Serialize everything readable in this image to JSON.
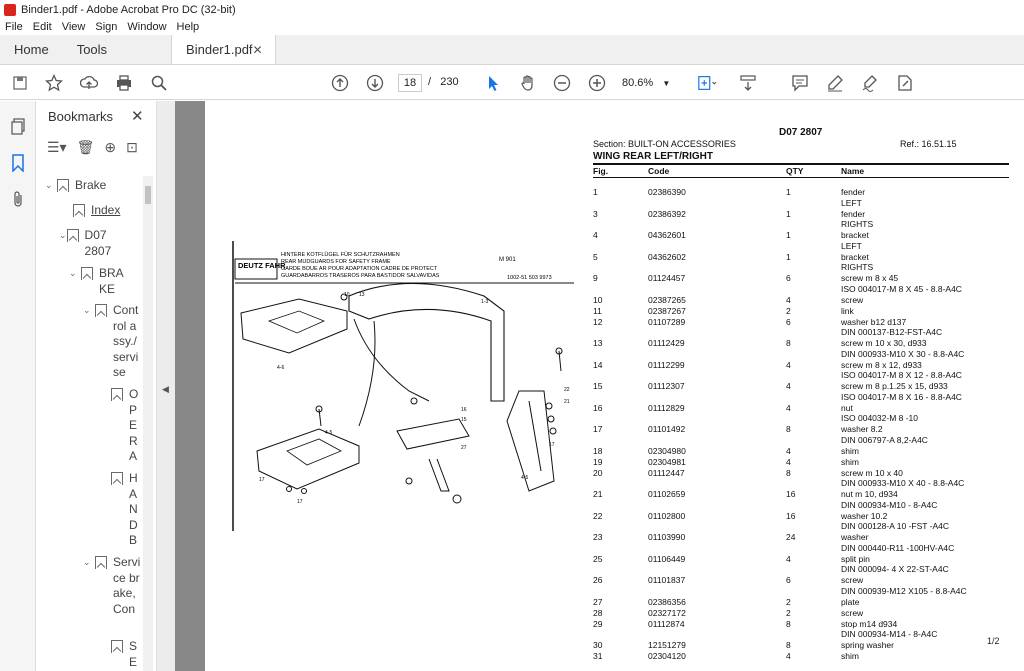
{
  "window": {
    "title": "Binder1.pdf - Adobe Acrobat Pro DC (32-bit)"
  },
  "menu": [
    "File",
    "Edit",
    "View",
    "Sign",
    "Window",
    "Help"
  ],
  "tabs": {
    "home": "Home",
    "tools": "Tools",
    "doc": "Binder1.pdf"
  },
  "toolbar": {
    "page_current": "18",
    "page_sep": "/",
    "page_total": "230",
    "zoom": "80.6%"
  },
  "bookmarks": {
    "title": "Bookmarks",
    "items": [
      {
        "label": "Brake",
        "caret": "⌄"
      },
      {
        "label": "Index",
        "caret": ""
      },
      {
        "label": "D07 2807",
        "caret": "⌄"
      },
      {
        "label": "BRAKE",
        "caret": "⌄"
      },
      {
        "label": "Control assy./servise",
        "caret": "⌄"
      },
      {
        "label": "OPERA",
        "caret": ""
      },
      {
        "label": "HANDB",
        "caret": ""
      },
      {
        "label": "Service brake, Con",
        "caret": "⌄"
      },
      {
        "label": "SE",
        "caret": ""
      }
    ]
  },
  "page": {
    "doc_code": "D07 2807",
    "section": "Section: BUILT-ON ACCESSORIES",
    "ref": "Ref.: 16.51.15",
    "heading": "WING REAR LEFT/RIGHT",
    "cols": [
      "Fig.",
      "Code",
      "QTY",
      "Name"
    ],
    "diagram_caption": [
      "HINTERE KOTFLÜGEL FÜR SCHUTZRAHMEN",
      "REAR MUDGUARDS FOR SAFETY FRAME",
      "GARDE BOUE AR POUR ADAPTATION CADRE DE PROTECT",
      "GUARDABARROS TRASEROS PARA BASTIDOR SALVAVIDAS"
    ],
    "diagram_brand": "DEUTZ FAHR",
    "diagram_code": "M 901",
    "diagram_ref": "1002-51 503 9973",
    "page_footer": "1/2",
    "rows": [
      {
        "fig": "1",
        "code": "02386390",
        "qty": "1",
        "name": "fender"
      },
      {
        "fig": "",
        "code": "",
        "qty": "",
        "name": "LEFT"
      },
      {
        "fig": "3",
        "code": "02386392",
        "qty": "1",
        "name": "fender"
      },
      {
        "fig": "",
        "code": "",
        "qty": "",
        "name": "RIGHTS"
      },
      {
        "fig": "4",
        "code": "04362601",
        "qty": "1",
        "name": "bracket"
      },
      {
        "fig": "",
        "code": "",
        "qty": "",
        "name": "LEFT"
      },
      {
        "fig": "5",
        "code": "04362602",
        "qty": "1",
        "name": "bracket"
      },
      {
        "fig": "",
        "code": "",
        "qty": "",
        "name": "RIGHTS"
      },
      {
        "fig": "9",
        "code": "01124457",
        "qty": "6",
        "name": "screw m 8 x 45"
      },
      {
        "fig": "",
        "code": "",
        "qty": "",
        "name": "ISO 004017-M 8 X 45 - 8.8-A4C"
      },
      {
        "fig": "10",
        "code": "02387265",
        "qty": "4",
        "name": "screw"
      },
      {
        "fig": "11",
        "code": "02387267",
        "qty": "2",
        "name": "link"
      },
      {
        "fig": "12",
        "code": "01107289",
        "qty": "6",
        "name": "washer b12 d137"
      },
      {
        "fig": "",
        "code": "",
        "qty": "",
        "name": "DIN 000137-B12-FST-A4C"
      },
      {
        "fig": "13",
        "code": "01112429",
        "qty": "8",
        "name": "screw m 10 x 30, d933"
      },
      {
        "fig": "",
        "code": "",
        "qty": "",
        "name": "DIN 000933-M10 X 30 - 8.8-A4C"
      },
      {
        "fig": "14",
        "code": "01112299",
        "qty": "4",
        "name": "screw m 8 x 12, d933"
      },
      {
        "fig": "",
        "code": "",
        "qty": "",
        "name": "ISO 004017-M 8 X 12 - 8.8-A4C"
      },
      {
        "fig": "15",
        "code": "01112307",
        "qty": "4",
        "name": "screw m 8 p.1.25 x 15, d933"
      },
      {
        "fig": "",
        "code": "",
        "qty": "",
        "name": "ISO 004017-M 8 X 16 - 8.8-A4C"
      },
      {
        "fig": "16",
        "code": "01112829",
        "qty": "4",
        "name": "nut"
      },
      {
        "fig": "",
        "code": "",
        "qty": "",
        "name": "ISO 004032-M 8 -10"
      },
      {
        "fig": "17",
        "code": "01101492",
        "qty": "8",
        "name": "washer 8.2"
      },
      {
        "fig": "",
        "code": "",
        "qty": "",
        "name": "DIN 006797-A 8,2-A4C"
      },
      {
        "fig": "18",
        "code": "02304980",
        "qty": "4",
        "name": "shim"
      },
      {
        "fig": "19",
        "code": "02304981",
        "qty": "4",
        "name": "shim"
      },
      {
        "fig": "20",
        "code": "01112447",
        "qty": "8",
        "name": "screw m 10 x 40"
      },
      {
        "fig": "",
        "code": "",
        "qty": "",
        "name": "DIN 000933-M10 X 40 - 8.8-A4C"
      },
      {
        "fig": "21",
        "code": "01102659",
        "qty": "16",
        "name": "nut m 10, d934"
      },
      {
        "fig": "",
        "code": "",
        "qty": "",
        "name": "DIN 000934-M10 - 8-A4C"
      },
      {
        "fig": "22",
        "code": "01102800",
        "qty": "16",
        "name": "washer 10.2"
      },
      {
        "fig": "",
        "code": "",
        "qty": "",
        "name": "DIN 000128-A 10 -FST -A4C"
      },
      {
        "fig": "23",
        "code": "01103990",
        "qty": "24",
        "name": "washer"
      },
      {
        "fig": "",
        "code": "",
        "qty": "",
        "name": "DIN 000440-R11 -100HV-A4C"
      },
      {
        "fig": "25",
        "code": "01106449",
        "qty": "4",
        "name": "split pin"
      },
      {
        "fig": "",
        "code": "",
        "qty": "",
        "name": "DIN 000094- 4 X 22-ST-A4C"
      },
      {
        "fig": "26",
        "code": "01101837",
        "qty": "6",
        "name": "screw"
      },
      {
        "fig": "",
        "code": "",
        "qty": "",
        "name": "DIN 000939-M12 X105 - 8.8-A4C"
      },
      {
        "fig": "27",
        "code": "02386356",
        "qty": "2",
        "name": "plate"
      },
      {
        "fig": "28",
        "code": "02327172",
        "qty": "2",
        "name": "screw"
      },
      {
        "fig": "29",
        "code": "01112874",
        "qty": "8",
        "name": "stop m14 d934"
      },
      {
        "fig": "",
        "code": "",
        "qty": "",
        "name": "DIN 000934-M14 - 8-A4C"
      },
      {
        "fig": "30",
        "code": "12151279",
        "qty": "8",
        "name": "spring washer"
      },
      {
        "fig": "31",
        "code": "02304120",
        "qty": "4",
        "name": "shim"
      }
    ]
  }
}
